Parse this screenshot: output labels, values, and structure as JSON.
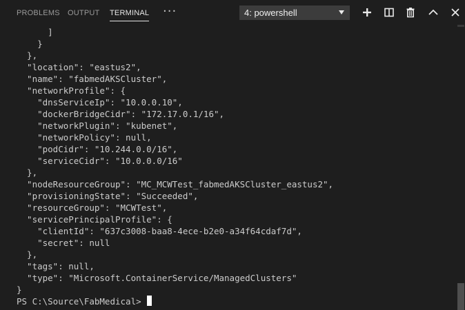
{
  "panel": {
    "tabs": [
      {
        "label": "PROBLEMS",
        "active": false
      },
      {
        "label": "OUTPUT",
        "active": false
      },
      {
        "label": "TERMINAL",
        "active": true
      }
    ],
    "more_label": "···",
    "terminal_selector": {
      "value": "4: powershell"
    },
    "actions": [
      {
        "name": "new-terminal",
        "icon": "plus-icon"
      },
      {
        "name": "split-terminal",
        "icon": "split-icon"
      },
      {
        "name": "kill-terminal",
        "icon": "trash-icon"
      },
      {
        "name": "maximize-panel",
        "icon": "chevron-up-icon"
      },
      {
        "name": "close-panel",
        "icon": "close-icon"
      }
    ]
  },
  "terminal": {
    "lines": [
      "      ]",
      "    }",
      "  },",
      "  \"location\": \"eastus2\",",
      "  \"name\": \"fabmedAKSCluster\",",
      "  \"networkProfile\": {",
      "    \"dnsServiceIp\": \"10.0.0.10\",",
      "    \"dockerBridgeCidr\": \"172.17.0.1/16\",",
      "    \"networkPlugin\": \"kubenet\",",
      "    \"networkPolicy\": null,",
      "    \"podCidr\": \"10.244.0.0/16\",",
      "    \"serviceCidr\": \"10.0.0.0/16\"",
      "  },",
      "  \"nodeResourceGroup\": \"MC_MCWTest_fabmedAKSCluster_eastus2\",",
      "  \"provisioningState\": \"Succeeded\",",
      "  \"resourceGroup\": \"MCWTest\",",
      "  \"servicePrincipalProfile\": {",
      "    \"clientId\": \"637c3008-baa8-4ece-b2e0-a34f64cdaf7d\",",
      "    \"secret\": null",
      "  },",
      "  \"tags\": null,",
      "  \"type\": \"Microsoft.ContainerService/ManagedClusters\"",
      "}"
    ],
    "prompt": "PS C:\\Source\\FabMedical> "
  },
  "colors": {
    "background": "#1e1e1e",
    "text": "#cccccc",
    "tab_active": "#e7e7e7",
    "tab_inactive": "#9a9a9a"
  }
}
